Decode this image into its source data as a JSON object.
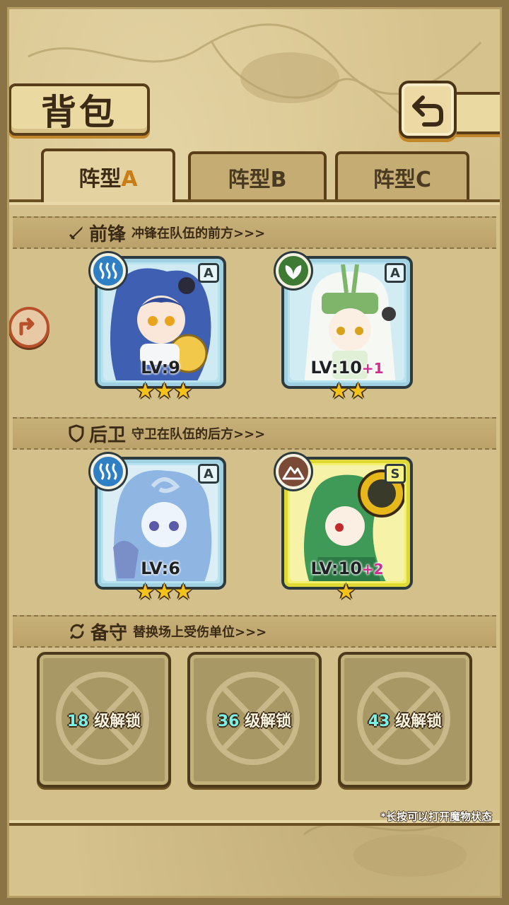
{
  "header": {
    "title": "背包"
  },
  "tabs": [
    {
      "label_prefix": "阵型",
      "label_letter": "A",
      "active": true
    },
    {
      "label_prefix": "阵型",
      "label_letter": "B",
      "active": false
    },
    {
      "label_prefix": "阵型",
      "label_letter": "C",
      "active": false
    }
  ],
  "sections": {
    "front": {
      "title": "前锋",
      "subtitle": "冲锋在队伍的前方>>>"
    },
    "back": {
      "title": "后卫",
      "subtitle": "守卫在队伍的后方>>>"
    },
    "reserve": {
      "title": "备守",
      "subtitle": "替换场上受伤单位>>>"
    }
  },
  "monsters": [
    {
      "element": "water-icon",
      "rank": "A",
      "lv_label": "LV:",
      "level": "9",
      "bonus": "",
      "stars": "★★★",
      "frame": "blue"
    },
    {
      "element": "leaf-icon",
      "rank": "A",
      "lv_label": "LV:",
      "level": "10",
      "bonus": "+1",
      "stars": "★★",
      "frame": "blue"
    },
    {
      "element": "water-icon",
      "rank": "A",
      "lv_label": "LV:",
      "level": "6",
      "bonus": "",
      "stars": "★★★",
      "frame": "blue"
    },
    {
      "element": "mountain-icon",
      "rank": "S",
      "lv_label": "LV:",
      "level": "10",
      "bonus": "+2",
      "stars": "★",
      "frame": "gold"
    }
  ],
  "locked_slots": [
    {
      "level": "18",
      "suffix": "级解锁"
    },
    {
      "level": "36",
      "suffix": "级解锁"
    },
    {
      "level": "43",
      "suffix": "级解锁"
    }
  ],
  "footnote": "*长按可以打开魔物状态",
  "colors": {
    "parchment": "#d6c28c",
    "frame_brown": "#5a3e1a",
    "accent_orange": "#c97d14",
    "water_elem": "#2f7fc4",
    "leaf_elem": "#3e7a34",
    "mountain_elem": "#7a4a36",
    "unlock_level": "#7cf0e8",
    "bonus_pink": "#d22c8c",
    "star_gold": "#f5c21a"
  }
}
